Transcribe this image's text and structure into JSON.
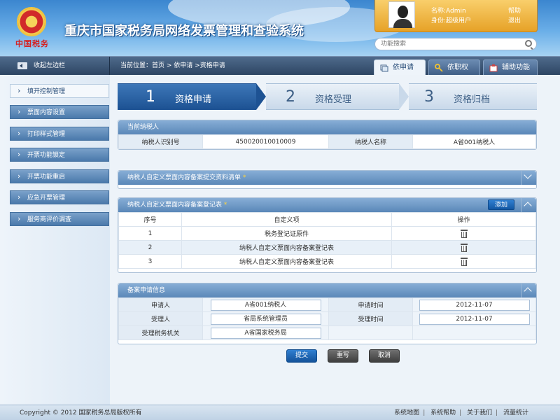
{
  "header": {
    "emblem_text": "中国税务",
    "title": "重庆市国家税务局网络发票管理和查验系统",
    "user": {
      "name": "名称:Admin",
      "role": "身份:超级用户"
    },
    "links": {
      "help": "帮助",
      "logout": "退出"
    },
    "search": {
      "placeholder": "功能搜索"
    }
  },
  "navbar": {
    "collapse_label": "收起左边栏",
    "breadcrumb": "当前位置：首页 > 依申请 >资格申请",
    "tabs": [
      {
        "label": "依申请",
        "icon": "window-icon",
        "active": true
      },
      {
        "label": "依职权",
        "icon": "key-icon",
        "active": false
      },
      {
        "label": "辅助功能",
        "icon": "tool-icon",
        "active": false
      }
    ]
  },
  "sidebar": {
    "items": [
      {
        "label": "填开控制管理",
        "active": true
      },
      {
        "label": "票面内容设置",
        "active": false
      },
      {
        "label": "打印样式管理",
        "active": false
      },
      {
        "label": "开票功能锁定",
        "active": false
      },
      {
        "label": "开票功能重启",
        "active": false
      },
      {
        "label": "应急开票管理",
        "active": false
      },
      {
        "label": "服务商评价调查",
        "active": false
      }
    ]
  },
  "steps": [
    {
      "num": "1",
      "label": "资格申请",
      "active": true
    },
    {
      "num": "2",
      "label": "资格受理",
      "active": false
    },
    {
      "num": "3",
      "label": "资格归档",
      "active": false
    }
  ],
  "taxpayer": {
    "title": "当前纳税人",
    "id_label": "纳税人识别号",
    "id_value": "450020010010009",
    "name_label": "纳税人名称",
    "name_value": "A省001纳税人"
  },
  "materials": {
    "title": "纳税人自定义票面内容备案提交资料清单",
    "required_mark": "*"
  },
  "register": {
    "title": "纳税人自定义票面内容备案登记表",
    "required_mark": "*",
    "add_label": "添加",
    "columns": [
      "序号",
      "自定义项",
      "操作"
    ],
    "rows": [
      {
        "no": "1",
        "item": "税务登记证原件"
      },
      {
        "no": "2",
        "item": "纳税人自定义票面内容备案登记表"
      },
      {
        "no": "3",
        "item": "纳税人自定义票面内容备案登记表"
      }
    ]
  },
  "application": {
    "title": "备案申请信息",
    "applicant_label": "申请人",
    "applicant_value": "A省001纳税人",
    "apply_time_label": "申请时间",
    "apply_time_value": "2012-11-07",
    "handler_label": "受理人",
    "handler_value": "省局系统管理员",
    "handle_time_label": "受理时间",
    "handle_time_value": "2012-11-07",
    "office_label": "受理税务机关",
    "office_value": "A省国家税务局"
  },
  "actions": {
    "submit": "提交",
    "rewrite": "重写",
    "cancel": "取消"
  },
  "footer": {
    "copyright": "Copyright © 2012 国家税务总局版权所有",
    "links": [
      "系统地图",
      "系统帮助",
      "关于我们",
      "流量统计"
    ]
  }
}
